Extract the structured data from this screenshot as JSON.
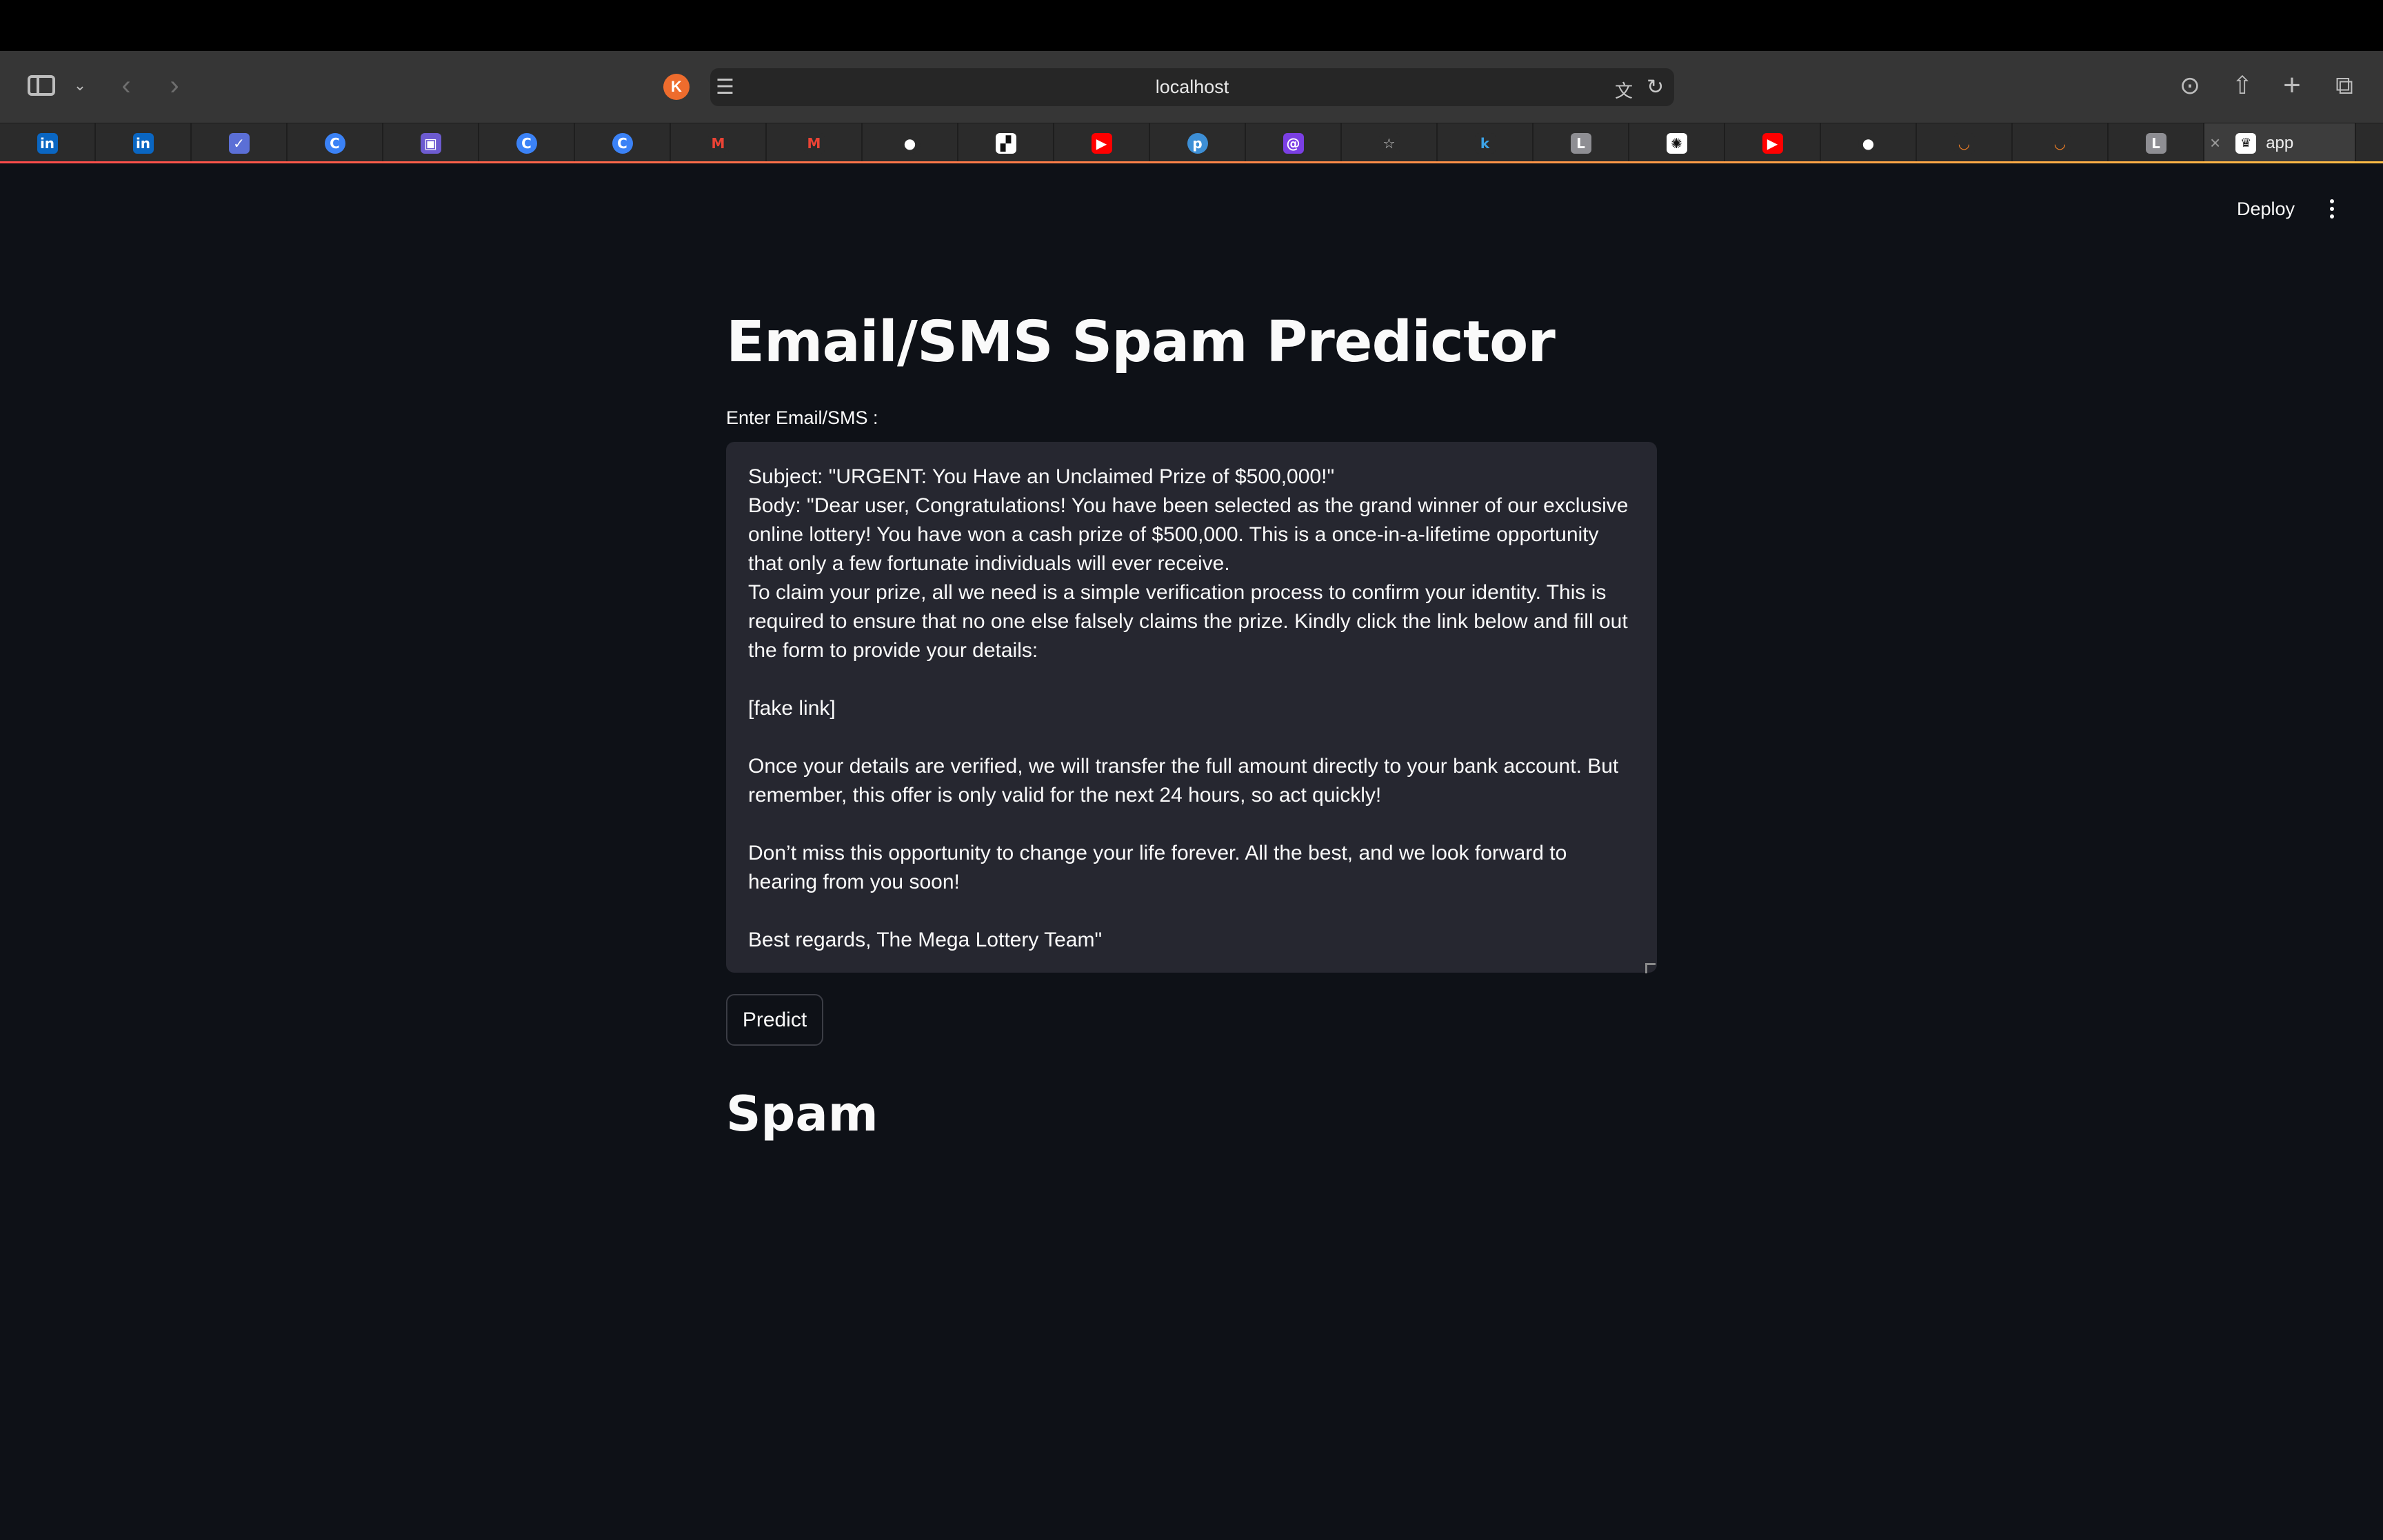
{
  "browser": {
    "address_text": "localhost",
    "site_avatar_letter": "K",
    "active_tab_title": "app",
    "tab_favicons": [
      {
        "icon": "linkedin-icon",
        "glyph": "in",
        "bg": "#0a66c2",
        "fg": "#ffffff"
      },
      {
        "icon": "linkedin-icon",
        "glyph": "in",
        "bg": "#0a66c2",
        "fg": "#ffffff"
      },
      {
        "icon": "app-icon",
        "glyph": "✓",
        "bg": "#5b6fd6",
        "fg": "#ffffff"
      },
      {
        "icon": "canva-icon",
        "glyph": "C",
        "bg": "#3b82f6",
        "fg": "#ffffff",
        "round": true
      },
      {
        "icon": "gallery-icon",
        "glyph": "▣",
        "bg": "#6d5bd0",
        "fg": "#ffffff"
      },
      {
        "icon": "canva-icon",
        "glyph": "C",
        "bg": "#3b82f6",
        "fg": "#ffffff",
        "round": true
      },
      {
        "icon": "canva-icon",
        "glyph": "C",
        "bg": "#3b82f6",
        "fg": "#ffffff",
        "round": true
      },
      {
        "icon": "gmail-icon",
        "glyph": "M",
        "bg": "#2b2b2b",
        "fg": "#ea4335"
      },
      {
        "icon": "gmail-icon",
        "glyph": "M",
        "bg": "#2b2b2b",
        "fg": "#ea4335"
      },
      {
        "icon": "github-icon",
        "glyph": "●",
        "bg": "#2b2b2b",
        "fg": "#ffffff",
        "round": true
      },
      {
        "icon": "chess-icon",
        "glyph": "▞",
        "bg": "#ffffff",
        "fg": "#111111"
      },
      {
        "icon": "youtube-icon",
        "glyph": "▶",
        "bg": "#ff0000",
        "fg": "#ffffff"
      },
      {
        "icon": "p-icon",
        "glyph": "p",
        "bg": "#3d8fd6",
        "fg": "#ffffff",
        "round": true
      },
      {
        "icon": "swirl-icon",
        "glyph": "@",
        "bg": "#7b3fe4",
        "fg": "#ffffff"
      },
      {
        "icon": "bookmark-star-icon",
        "glyph": "☆",
        "bg": "#2b2b2b",
        "fg": "#c8c8c8"
      },
      {
        "icon": "k-icon",
        "glyph": "k",
        "bg": "#2b2b2b",
        "fg": "#3ca3e6"
      },
      {
        "icon": "letter-l-icon",
        "glyph": "L",
        "bg": "#8e8e93",
        "fg": "#ffffff"
      },
      {
        "icon": "chatgpt-icon",
        "glyph": "✺",
        "bg": "#ffffff",
        "fg": "#111111"
      },
      {
        "icon": "youtube-icon",
        "glyph": "▶",
        "bg": "#ff0000",
        "fg": "#ffffff"
      },
      {
        "icon": "github-icon",
        "glyph": "●",
        "bg": "#2b2b2b",
        "fg": "#ffffff",
        "round": true
      },
      {
        "icon": "arc-icon",
        "glyph": "◡",
        "bg": "#2b2b2b",
        "fg": "#f48024"
      },
      {
        "icon": "arc-icon",
        "glyph": "◡",
        "bg": "#2b2b2b",
        "fg": "#f48024"
      },
      {
        "icon": "letter-l-icon",
        "glyph": "L",
        "bg": "#8e8e93",
        "fg": "#ffffff"
      }
    ]
  },
  "app": {
    "deploy_label": "Deploy",
    "title": "Email/SMS Spam Predictor",
    "input_label": "Enter Email/SMS :",
    "input_value": "Subject: \"URGENT: You Have an Unclaimed Prize of $500,000!\"\nBody: \"Dear user, Congratulations! You have been selected as the grand winner of our exclusive online lottery! You have won a cash prize of $500,000. This is a once-in-a-lifetime opportunity that only a few fortunate individuals will ever receive.\nTo claim your prize, all we need is a simple verification process to confirm your identity. This is required to ensure that no one else falsely claims the prize. Kindly click the link below and fill out the form to provide your details:\n\n[fake link]\n\nOnce your details are verified, we will transfer the full amount directly to your bank account. But remember, this offer is only valid for the next 24 hours, so act quickly!\n\nDon’t miss this opportunity to change your life forever. All the best, and we look forward to hearing from you soon!\n\nBest regards, The Mega Lottery Team\"",
    "predict_label": "Predict",
    "result": "Spam"
  },
  "colors": {
    "background": "#0e1117",
    "input_background": "#262730",
    "toolbar": "#363636",
    "tab_bar": "#2b2b2b"
  }
}
